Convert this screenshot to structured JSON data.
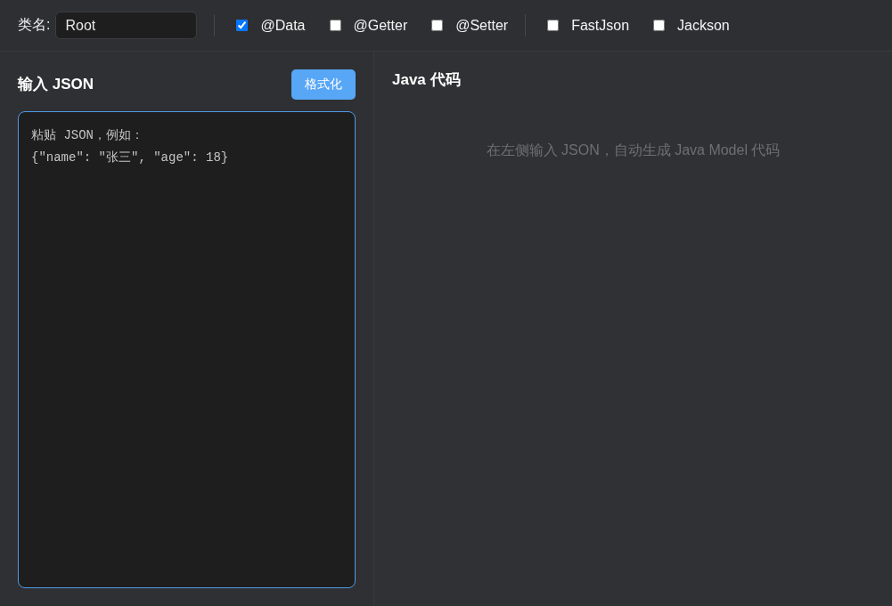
{
  "toolbar": {
    "class_name": {
      "label": "类名:",
      "value": "Root"
    },
    "option_groups": [
      {
        "options": [
          {
            "label": "@Data",
            "checked": true
          },
          {
            "label": "@Getter",
            "checked": false
          },
          {
            "label": "@Setter",
            "checked": false
          }
        ]
      },
      {
        "options": [
          {
            "label": "FastJson",
            "checked": false
          },
          {
            "label": "Jackson",
            "checked": false
          }
        ]
      }
    ]
  },
  "input_panel": {
    "title": "输入 JSON",
    "format_button": "格式化",
    "editor": {
      "placeholder": "粘贴 JSON，例如：\n{\"name\": \"张三\", \"age\": 18}"
    }
  },
  "output_panel": {
    "title": "Java 代码",
    "empty_message": "在左侧输入 JSON，自动生成 Java Model 代码"
  }
}
